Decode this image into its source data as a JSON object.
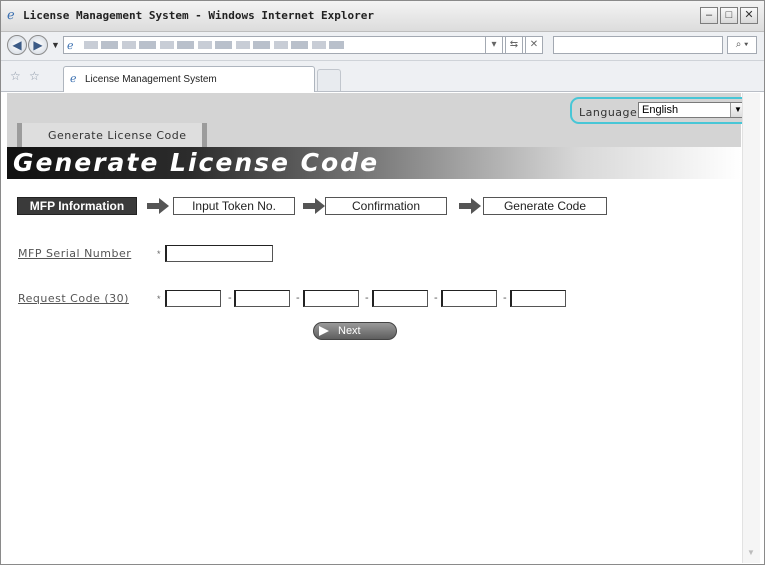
{
  "window": {
    "title": "License Management System - Windows Internet Explorer",
    "ie_icon": "ie-logo-icon",
    "minimize_icon": "minimize-icon",
    "maximize_icon": "maximize-icon",
    "close_icon": "close-icon"
  },
  "toolbar": {
    "back_icon": "back-arrow-icon",
    "forward_icon": "forward-arrow-icon",
    "refresh_icon": "refresh-icon",
    "stop_icon": "stop-icon",
    "search_icon": "search-icon"
  },
  "tabs": [
    {
      "label": "License Management System"
    }
  ],
  "page": {
    "language": {
      "label": "Language",
      "selected": "English"
    },
    "section_tab": "Generate License Code",
    "banner_title": "Generate License Code",
    "steps": [
      {
        "label": "MFP Information",
        "active": true
      },
      {
        "label": "Input Token No.",
        "active": false
      },
      {
        "label": "Confirmation",
        "active": false
      },
      {
        "label": "Generate Code",
        "active": false
      }
    ],
    "fields": {
      "serial": {
        "label": "MFP Serial Number",
        "required_mark": "*",
        "value": ""
      },
      "request_code": {
        "label": "Request Code (30)",
        "required_mark": "*",
        "separator": "-",
        "segments": [
          "",
          "",
          "",
          "",
          "",
          ""
        ]
      }
    },
    "next_button": "Next"
  },
  "colors": {
    "language_highlight": "#48c6d6",
    "active_step_bg": "#3a3a3a"
  }
}
